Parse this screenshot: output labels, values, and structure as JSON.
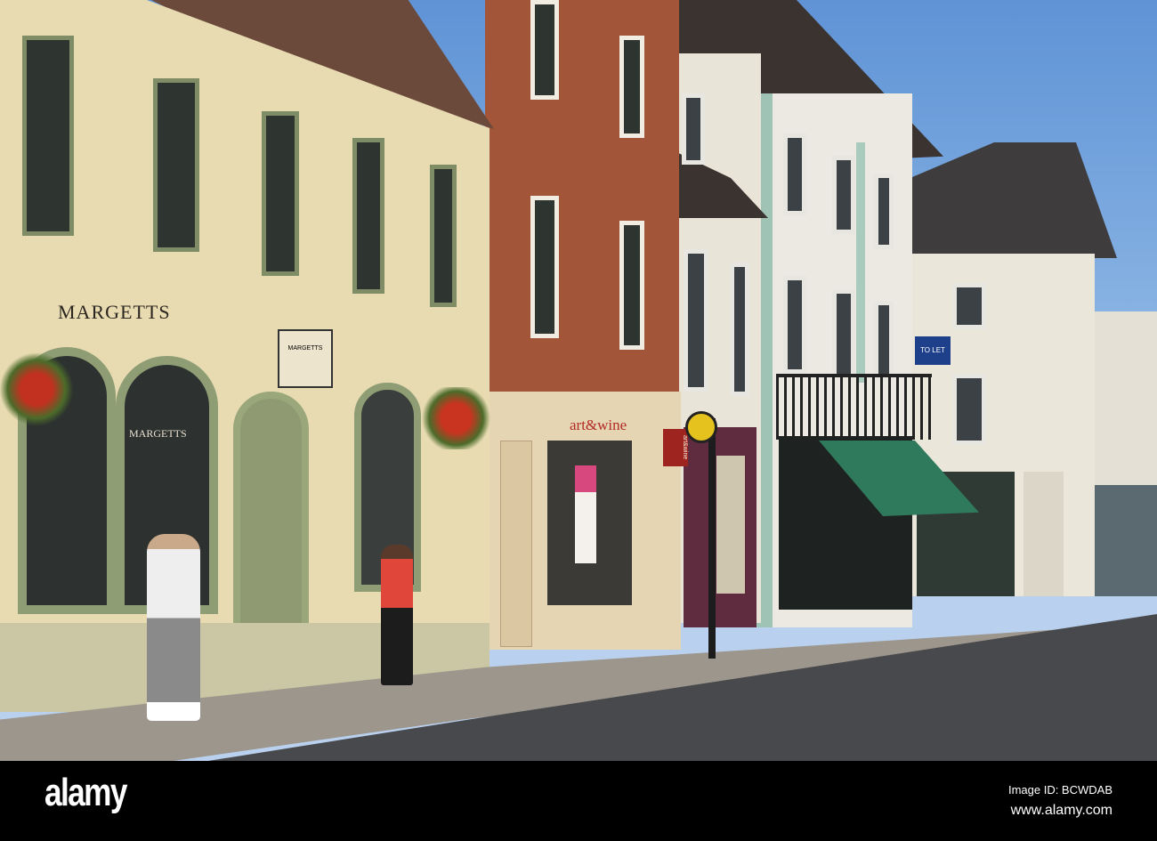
{
  "scene": {
    "description_text": {
      "shop_sign_main": "MARGETTS",
      "shop_window_sign": "MARGETTS",
      "hanging_sign": "MARGETTS",
      "shop_sign_wine": "art&wine",
      "hanging_sign_wine": "art&wine",
      "to_let_sign": "TO LET"
    },
    "colors": {
      "sky": "#6f9fd8",
      "cream_facade": "#e8dbb2",
      "brick": "#a3553a",
      "awning": "#2f7a5c",
      "road": "#48494c"
    }
  },
  "watermark": {
    "logo": "alamy",
    "image_id": "Image ID: BCWDAB",
    "url": "www.alamy.com"
  }
}
